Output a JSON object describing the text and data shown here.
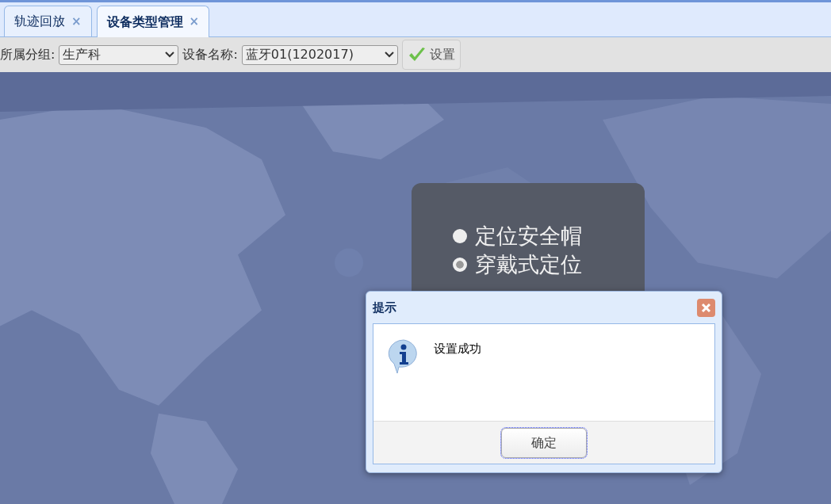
{
  "tabs": [
    {
      "label": "轨迹回放",
      "close": "×",
      "selected": false
    },
    {
      "label": "设备类型管理",
      "close": "×",
      "selected": true
    }
  ],
  "toolbar": {
    "group_label": "所属分组:",
    "group_value": "生产科",
    "device_label": "设备名称:",
    "device_value": "蓝牙01(1202017)",
    "set_button": "设置"
  },
  "type_panel": {
    "options": [
      {
        "label": "定位安全帽",
        "selected": false
      },
      {
        "label": "穿戴式定位",
        "selected": true
      }
    ]
  },
  "dialog": {
    "title": "提示",
    "message": "设置成功",
    "ok_button": "确定"
  }
}
